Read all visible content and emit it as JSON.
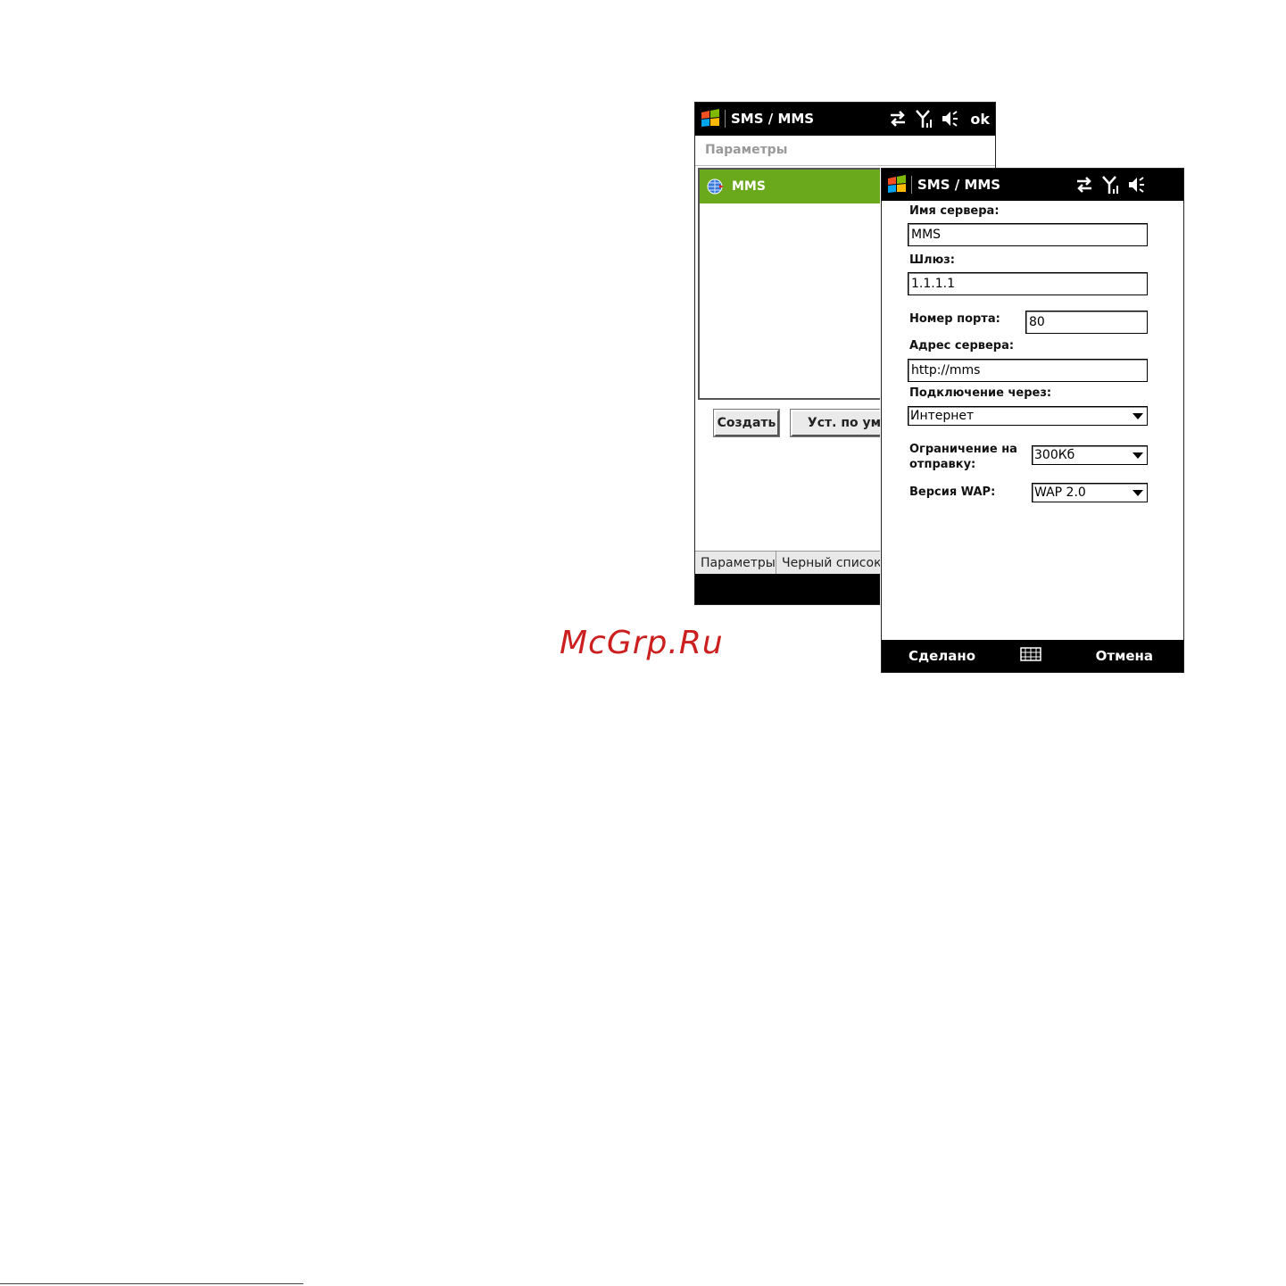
{
  "screen1": {
    "app_title": "SMS / MMS",
    "ok_label": "ok",
    "subheader": "Параметры",
    "list_items": [
      {
        "label": "MMS"
      }
    ],
    "create_button": "Создать",
    "default_button": "Уст. по ум",
    "tabs": [
      "Параметры",
      "Черный список"
    ]
  },
  "screen2": {
    "app_title": "SMS / MMS",
    "server_name_label": "Имя сервера:",
    "server_name_value": "MMS",
    "gateway_label": "Шлюз:",
    "gateway_value": "1.1.1.1",
    "port_label": "Номер порта:",
    "port_value": "80",
    "server_address_label": "Адрес сервера:",
    "server_address_value": "http://mms",
    "connect_via_label": "Подключение через:",
    "connect_via_value": "Интернет",
    "send_limit_label_line1": "Ограничение на",
    "send_limit_label_line2": "отправку:",
    "send_limit_value": "300Кб",
    "wap_version_label": "Версия WAP:",
    "wap_version_value": "WAP 2.0",
    "done_softkey": "Сделано",
    "cancel_softkey": "Отмена"
  },
  "watermark": "McGrp.Ru",
  "colors": {
    "titlebar": "#000000",
    "selection": "#6aa91c",
    "watermark": "#cc1f1f"
  },
  "icons": [
    "windows-start-icon",
    "connectivity-icon",
    "signal-icon",
    "speaker-icon",
    "globe-icon",
    "keyboard-icon"
  ]
}
